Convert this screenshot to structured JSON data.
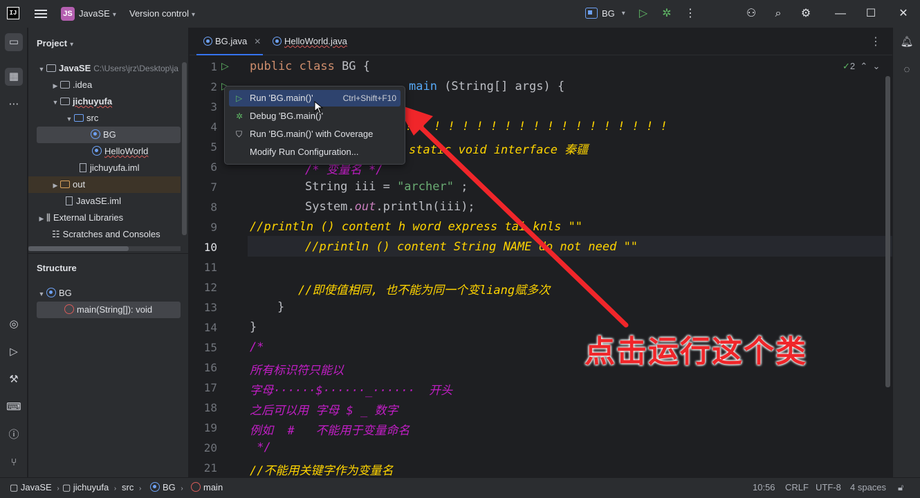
{
  "titlebar": {
    "project_badge": "JS",
    "project_name": "JavaSE",
    "version_control": "Version control",
    "run_config": "BG"
  },
  "project_panel": {
    "title": "Project",
    "tree": [
      {
        "label": "JavaSE",
        "note": "C:\\Users\\jrz\\Desktop\\ja"
      },
      {
        "label": ".idea"
      },
      {
        "label": "jichuyufa"
      },
      {
        "label": "src"
      },
      {
        "label": "BG"
      },
      {
        "label": "HelloWorld"
      },
      {
        "label": "jichuyufa.iml"
      },
      {
        "label": "out"
      },
      {
        "label": "JavaSE.iml"
      },
      {
        "label": "External Libraries"
      },
      {
        "label": "Scratches and Consoles"
      }
    ]
  },
  "structure_panel": {
    "title": "Structure",
    "items": [
      {
        "label": "BG"
      },
      {
        "label": "main(String[]): void"
      }
    ]
  },
  "tabs": [
    {
      "label": "BG.java"
    },
    {
      "label": "HelloWorld.java"
    }
  ],
  "inspection_count": "2",
  "line_numbers": [
    "1",
    "2",
    "3",
    "4",
    "5",
    "6",
    "7",
    "8",
    "9",
    "10",
    "11",
    "12",
    "13",
    "14",
    "15",
    "16",
    "17",
    "18",
    "19",
    "20",
    "21"
  ],
  "code": {
    "l1_kw": "public class",
    "l1_rest": " BG {",
    "l2_rest": "main",
    "l2_args": " (String[] args) {",
    "l3": ";",
    "l4": "! ! ! ! ! ! ! ! ! ! ! ! ! ! ! ! ! ! !",
    "l5": "static void interface 秦疆",
    "l6": "/* 变量名 */",
    "l7_a": "String iii = ",
    "l7_str": "\"archer\"",
    "l7_b": " ;",
    "l8_a": "System.",
    "l8_fld": "out",
    "l8_b": ".println(iii);",
    "l9": "//println () content h word express tai knls \"\"",
    "l10": "//println () content String NAME do not need \"\"",
    "l12": "//即使值相同, 也不能为同一个变liang赋多次",
    "l13": "}",
    "l14": "}",
    "l15": "/*",
    "l16": "所有标识符只能以",
    "l17": "字母······$······_······  开头",
    "l18": "之后可以用 字母 $ _ 数字",
    "l19": "例如  #   不能用于变量命名",
    "l20": " */",
    "l21": "//不能用关键字作为变量名"
  },
  "popup": {
    "items": [
      {
        "label": "Run 'BG.main()'",
        "shortcut": "Ctrl+Shift+F10"
      },
      {
        "label": "Debug 'BG.main()'"
      },
      {
        "label": "Run 'BG.main()' with Coverage"
      },
      {
        "label": "Modify Run Configuration..."
      }
    ]
  },
  "annotation": "点击运行这个类",
  "breadcrumbs": [
    "JavaSE",
    "jichuyufa",
    "src",
    "BG",
    "main"
  ],
  "status": {
    "position": "10:56",
    "line_sep": "CRLF",
    "encoding": "UTF-8",
    "indent": "4 spaces"
  },
  "colors": {
    "accent": "#3574f0",
    "annotation": "#f0262a",
    "run_green": "#5fb865"
  }
}
